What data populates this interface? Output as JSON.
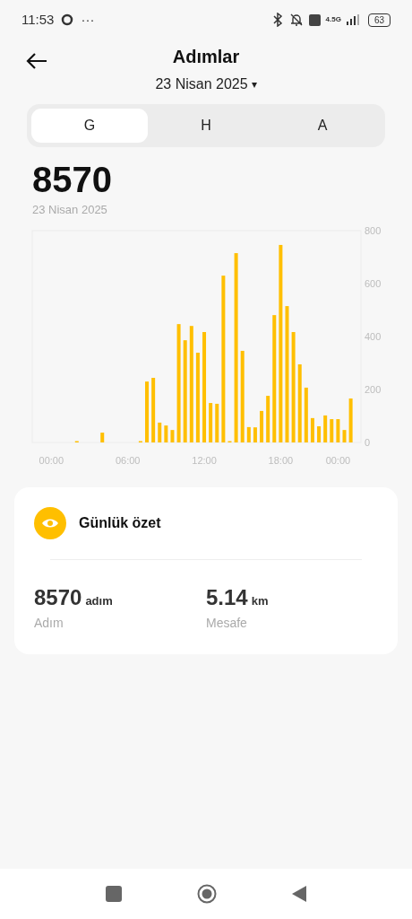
{
  "status_bar": {
    "time": "11:53",
    "more": "···",
    "network": "4.5G",
    "battery": "63"
  },
  "header": {
    "title": "Adımlar",
    "date": "23 Nisan 2025",
    "dropdown": "▾"
  },
  "tabs": [
    {
      "label": "G",
      "selected": true
    },
    {
      "label": "H",
      "selected": false
    },
    {
      "label": "A",
      "selected": false
    }
  ],
  "summary": {
    "value": "8570",
    "date": "23 Nisan 2025"
  },
  "chart_data": {
    "type": "bar",
    "color": "#ffbf00",
    "ylim": [
      0,
      800
    ],
    "yticks": [
      0,
      200,
      400,
      600,
      800
    ],
    "categories": [
      "00:00",
      null,
      null,
      null,
      null,
      null,
      null,
      null,
      null,
      null,
      null,
      null,
      "06:00",
      null,
      null,
      null,
      null,
      null,
      null,
      null,
      null,
      null,
      null,
      null,
      "12:00",
      null,
      null,
      null,
      null,
      null,
      null,
      null,
      null,
      null,
      null,
      null,
      "18:00",
      null,
      null,
      null,
      null,
      null,
      null,
      null,
      null,
      "00:00",
      null,
      null
    ],
    "values": [
      0,
      0,
      0,
      0,
      5,
      0,
      0,
      0,
      37,
      0,
      0,
      0,
      0,
      0,
      5,
      230,
      244,
      75,
      64,
      47,
      447,
      386,
      440,
      339,
      417,
      149,
      146,
      630,
      5,
      715,
      346,
      58,
      57,
      119,
      176,
      481,
      746,
      515,
      417,
      295,
      207,
      92,
      61,
      102,
      88,
      88,
      47,
      166
    ]
  },
  "card": {
    "title": "Günlük özet",
    "stats": [
      {
        "value": "8570",
        "unit": "adım",
        "label": "Adım"
      },
      {
        "value": "5.14",
        "unit": "km",
        "label": "Mesafe"
      }
    ]
  }
}
